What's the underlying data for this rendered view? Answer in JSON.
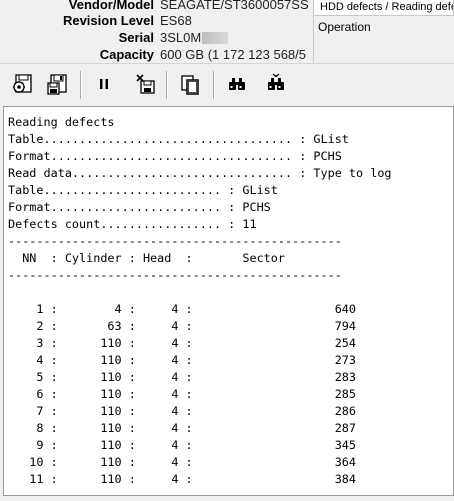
{
  "drive_info": {
    "vendor_model_label": "Vendor/Model",
    "vendor_model_value": "SEAGATE/ST3600057SS",
    "revision_label": "Revision Level",
    "revision_value": "ES68",
    "serial_label": "Serial",
    "serial_value": "3SL0M",
    "capacity_label": "Capacity",
    "capacity_value": "600 GB (1 172 123 568/5"
  },
  "right_panel": {
    "tab_title": "HDD defects / Reading defe",
    "operation_label": "Operation"
  },
  "toolbar": {
    "icons": [
      "settings-disk-icon",
      "save-disk-icon",
      "pause-icon",
      "cancel-save-icon",
      "copy-icon",
      "binoculars-icon",
      "binoculars-next-icon"
    ]
  },
  "log": {
    "lines": [
      "Reading defects",
      "Table................................... : GList",
      "Format.................................. : PCHS",
      "Read data............................... : Type to log",
      "Table......................... : GList",
      "Format........................ : PCHS",
      "Defects count................. : 11",
      "-----------------------------------------------",
      "  NN  : Cylinder : Head  :       Sector",
      "-----------------------------------------------",
      "",
      "    1 :        4 :     4 :                    640",
      "    2 :       63 :     4 :                    794",
      "    3 :      110 :     4 :                    254",
      "    4 :      110 :     4 :                    273",
      "    5 :      110 :     4 :                    283",
      "    6 :      110 :     4 :                    285",
      "    7 :      110 :     4 :                    286",
      "    8 :      110 :     4 :                    287",
      "    9 :      110 :     4 :                    345",
      "   10 :      110 :     4 :                    364",
      "   11 :      110 :     4 :                    384",
      "-----------------------------------------------"
    ]
  }
}
